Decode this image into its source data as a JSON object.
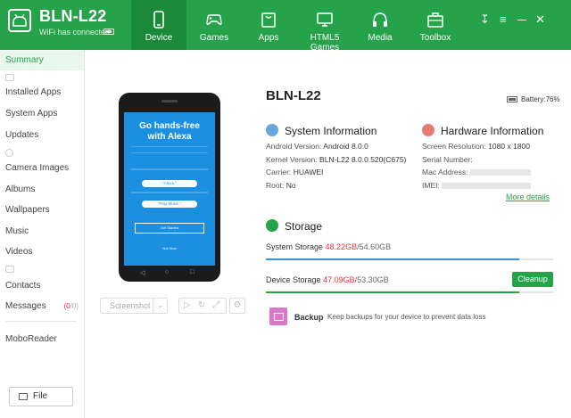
{
  "header": {
    "device_name": "BLN-L22",
    "connection": "WiFi has connected",
    "tabs": [
      {
        "label": "Device",
        "icon": "phone-icon",
        "active": true
      },
      {
        "label": "Games",
        "icon": "gamepad-icon"
      },
      {
        "label": "Apps",
        "icon": "bag-icon"
      },
      {
        "label": "HTML5 Games",
        "icon": "monitor-icon"
      },
      {
        "label": "Media",
        "icon": "headphones-icon"
      },
      {
        "label": "Toolbox",
        "icon": "toolbox-icon"
      }
    ],
    "accent": "#25a24a"
  },
  "sidebar": {
    "summary": "Summary",
    "installed_apps": "Installed Apps",
    "system_apps": "System Apps",
    "updates": "Updates",
    "camera_images": "Camera Images",
    "albums": "Albums",
    "wallpapers": "Wallpapers",
    "music": "Music",
    "videos": "Videos",
    "contacts": "Contacts",
    "messages": "Messages",
    "messages_badge_open": "(0",
    "messages_badge_rest": "/0)",
    "moboreader": "MoboReader",
    "file": "File"
  },
  "phone_screen": {
    "headline1": "Go hands-free",
    "headline2": "with Alexa",
    "prompt1": "\"Alexa.\"",
    "prompt2": "\"Play Music.\"",
    "get_started": "Get Started",
    "not_now": "Not Now"
  },
  "toolbar": {
    "screenshot": "Screenshot"
  },
  "device": {
    "model": "BLN-L22",
    "battery": "Battery:76%"
  },
  "system_info": {
    "title": "System Information",
    "android_label": "Android Version:",
    "android_value": "Android 8.0.0",
    "kernel_label": "Kernel Version:",
    "kernel_value": "BLN-L22 8.0.0.520(C675)",
    "carrier_label": "Carrier:",
    "carrier_value": "HUAWEI",
    "root_label": "Root:",
    "root_value": "No"
  },
  "hardware_info": {
    "title": "Hardware Information",
    "resolution_label": "Screen Resolution:",
    "resolution_value": "1080 x 1800",
    "serial_label": "Serial Number:",
    "mac_label": "Mac Address:",
    "imei_label": "IMEI:",
    "more": "More details"
  },
  "storage": {
    "title": "Storage",
    "system_label": "System Storage",
    "system_used": "48.22GB",
    "system_total": "/54.60GB",
    "system_fraction": 0.883,
    "device_label": "Device Storage",
    "device_used": "47.09GB",
    "device_total": "/53.30GB",
    "device_fraction": 0.883,
    "cleanup": "Cleanup"
  },
  "backup": {
    "title": "Backup",
    "desc": "Keep backups for your device to prevent data loss"
  }
}
